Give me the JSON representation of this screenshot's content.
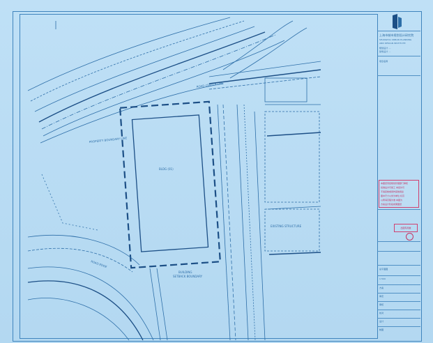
{
  "drawing": {
    "labels": {
      "building": "BLDG  (01)",
      "road_top": "ROAD CENTER LINE",
      "road_left": "PROPERTY BOUNDARY LINE",
      "bottom_label_1": "BUILDING",
      "bottom_label_2": "SETBACK BOUNDARY",
      "right_note": "EXISTING STRUCTURE",
      "lower_left_road": "ROAD EDGE"
    }
  },
  "title_block": {
    "company_line_1": "上海市城市规划设计研究院",
    "company_line_2": "SHANGHAI URBAN PLANNING",
    "company_line_3": "AND DESIGN INSTITUTE",
    "note_1": "规划设计 ...",
    "note_2": "建筑设计 ...",
    "project_label": "项目名称",
    "red_notes": [
      "本图纸须经规划管理部门审核",
      "批准后方可施工 未经许可",
      "不得复制或用作其他用途",
      "图中尺寸以米为单位 标高",
      "以黄海高程为准 本图为",
      "方案设计阶段成果图纸"
    ],
    "stamp_text": "出图专用章",
    "drawing_name": "总平面图",
    "scale": "1:500",
    "phase": "方案",
    "sign_rows": [
      "审定",
      "审核",
      "校对",
      "设计",
      "制图"
    ]
  },
  "colors": {
    "paper": "#b9dcf3",
    "line": "#2d6ea8",
    "dark_line": "#1c4f86",
    "red": "#c43464"
  }
}
